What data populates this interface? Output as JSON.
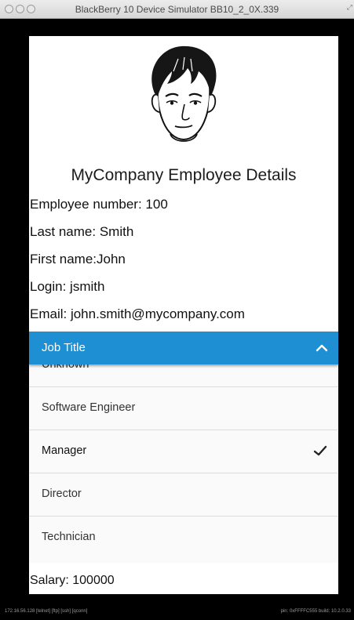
{
  "window": {
    "title": "BlackBerry 10 Device Simulator BB10_2_0X.339"
  },
  "employee": {
    "heading": "MyCompany Employee Details",
    "number": "Employee number: 100",
    "last_name": "Last name: Smith",
    "first_name": "First name:John",
    "login": "Login: jsmith",
    "email": "Email: john.smith@mycompany.com",
    "salary": "Salary: 100000"
  },
  "job_title_dropdown": {
    "label": "Job Title",
    "expanded": true,
    "options": [
      "Unknown",
      "Software Engineer",
      "Manager",
      "Director",
      "Technician"
    ],
    "selected": "Manager",
    "accent_color": "#1d8fd2"
  },
  "statusbar": {
    "left": "172.16.56.128    [telnet]  [ftp]  [ssh]  [qconn]",
    "right": "pin: 0xFFFFC555    build: 10.2.0.33"
  },
  "icons": [
    "chevron-up-icon",
    "checkmark-icon",
    "avatar-face"
  ]
}
